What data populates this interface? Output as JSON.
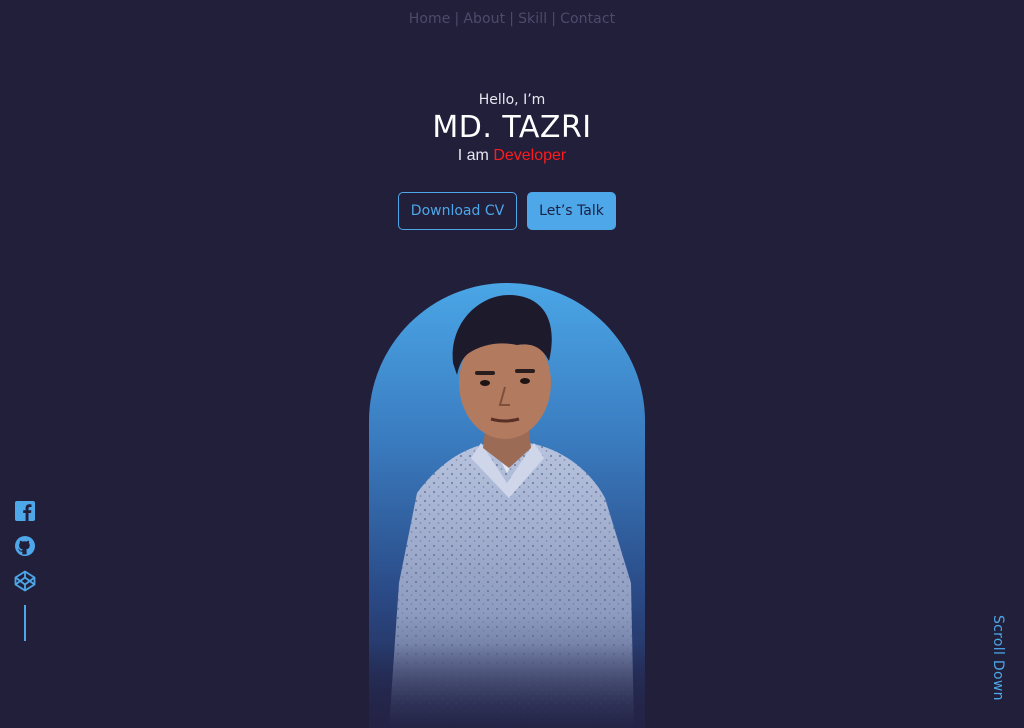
{
  "nav": {
    "items": [
      "Home",
      "About",
      "Skill",
      "Contact"
    ],
    "separator": "|"
  },
  "hero": {
    "greeting": "Hello, I’m",
    "name": "MD. TAZRI",
    "role_prefix": "I am",
    "role_highlight": "Developer"
  },
  "buttons": {
    "download_cv": "Download CV",
    "lets_talk": "Let’s Talk"
  },
  "socials": [
    {
      "icon": "facebook-icon"
    },
    {
      "icon": "github-icon"
    },
    {
      "icon": "codepen-icon"
    }
  ],
  "scroll_down": "Scroll Down",
  "colors": {
    "background": "#221f3a",
    "accent": "#4da7e8",
    "highlight": "#ff1b1b"
  }
}
